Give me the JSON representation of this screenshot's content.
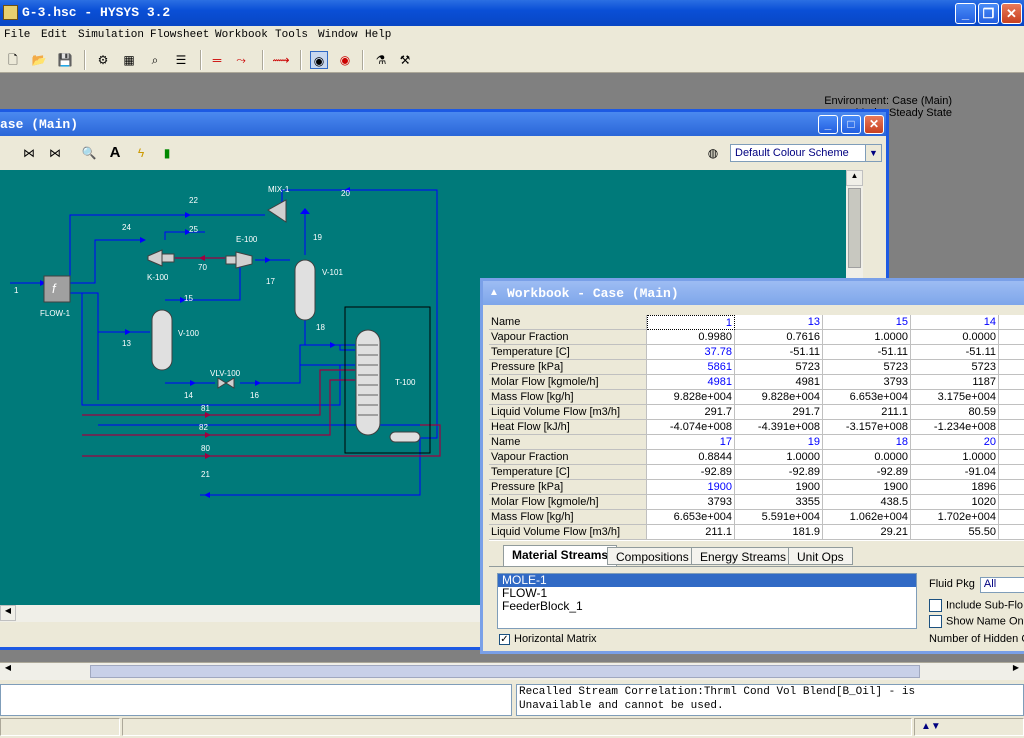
{
  "app": {
    "title": "G-3.hsc - HYSYS 3.2"
  },
  "menu": [
    "File",
    "Edit",
    "Simulation",
    "Flowsheet",
    "Workbook",
    "Tools",
    "Window",
    "Help"
  ],
  "environment": {
    "line1": "Environment: Case (Main)",
    "line2": "Mode: Steady State"
  },
  "pfd": {
    "title": "ase (Main)",
    "colour_scheme": "Default Colour Scheme",
    "labels": {
      "mix": "MIX-1",
      "flow": "FLOW-1",
      "k100": "K-100",
      "e100": "E-100",
      "v101": "V-101",
      "v100": "V-100",
      "vlv": "VLV-100",
      "t100": "T-100",
      "s1": "1",
      "s13": "13",
      "s14": "14",
      "s15": "15",
      "s16": "16",
      "s17": "17",
      "s18": "18",
      "s19": "19",
      "s20": "20",
      "s21": "21",
      "s22": "22",
      "s24": "24",
      "s25": "25",
      "s70": "70",
      "s80": "80",
      "s81": "81",
      "s82": "82"
    }
  },
  "workbook": {
    "title": "Workbook - Case (Main)",
    "table1": {
      "streams": [
        "1",
        "13",
        "15",
        "14"
      ],
      "rows": [
        {
          "label": "Vapour Fraction",
          "values": [
            "0.9980",
            "0.7616",
            "1.0000",
            "0.0000"
          ]
        },
        {
          "label": "Temperature [C]",
          "values": [
            "37.78",
            "-51.11",
            "-51.11",
            "-51.11"
          ]
        },
        {
          "label": "Pressure [kPa]",
          "values": [
            "5861",
            "5723",
            "5723",
            "5723"
          ]
        },
        {
          "label": "Molar Flow [kgmole/h]",
          "values": [
            "4981",
            "4981",
            "3793",
            "1187"
          ]
        },
        {
          "label": "Mass Flow [kg/h]",
          "values": [
            "9.828e+004",
            "9.828e+004",
            "6.653e+004",
            "3.175e+004"
          ]
        },
        {
          "label": "Liquid Volume Flow [m3/h]",
          "values": [
            "291.7",
            "291.7",
            "211.1",
            "80.59"
          ]
        },
        {
          "label": "Heat Flow [kJ/h]",
          "values": [
            "-4.074e+008",
            "-4.391e+008",
            "-3.157e+008",
            "-1.234e+008"
          ]
        }
      ]
    },
    "table2": {
      "streams": [
        "17",
        "19",
        "18",
        "20"
      ],
      "rows": [
        {
          "label": "Vapour Fraction",
          "values": [
            "0.8844",
            "1.0000",
            "0.0000",
            "1.0000"
          ]
        },
        {
          "label": "Temperature [C]",
          "values": [
            "-92.89",
            "-92.89",
            "-92.89",
            "-91.04"
          ]
        },
        {
          "label": "Pressure [kPa]",
          "values": [
            "1900",
            "1900",
            "1900",
            "1896"
          ]
        },
        {
          "label": "Molar Flow [kgmole/h]",
          "values": [
            "3793",
            "3355",
            "438.5",
            "1020"
          ]
        },
        {
          "label": "Mass Flow [kg/h]",
          "values": [
            "6.653e+004",
            "5.591e+004",
            "1.062e+004",
            "1.702e+004"
          ]
        },
        {
          "label": "Liquid Volume Flow [m3/h]",
          "values": [
            "211.1",
            "181.9",
            "29.21",
            "55.50"
          ]
        }
      ]
    },
    "name_label": "Name",
    "tabs": [
      "Material Streams",
      "Compositions",
      "Energy Streams",
      "Unit Ops"
    ],
    "list_items": [
      "MOLE-1",
      "FLOW-1",
      "FeederBlock_1"
    ],
    "horizontal_matrix": "Horizontal Matrix",
    "fluid_pkg_label": "Fluid Pkg",
    "fluid_pkg_value": "All",
    "include_sub": "Include Sub-Flo",
    "show_name": "Show Name On",
    "hidden": "Number of Hidden O"
  },
  "message": {
    "line1": "Recalled Stream Correlation:Thrml Cond Vol Blend[B_Oil] - is",
    "line2": "Unavailable and cannot be used."
  }
}
